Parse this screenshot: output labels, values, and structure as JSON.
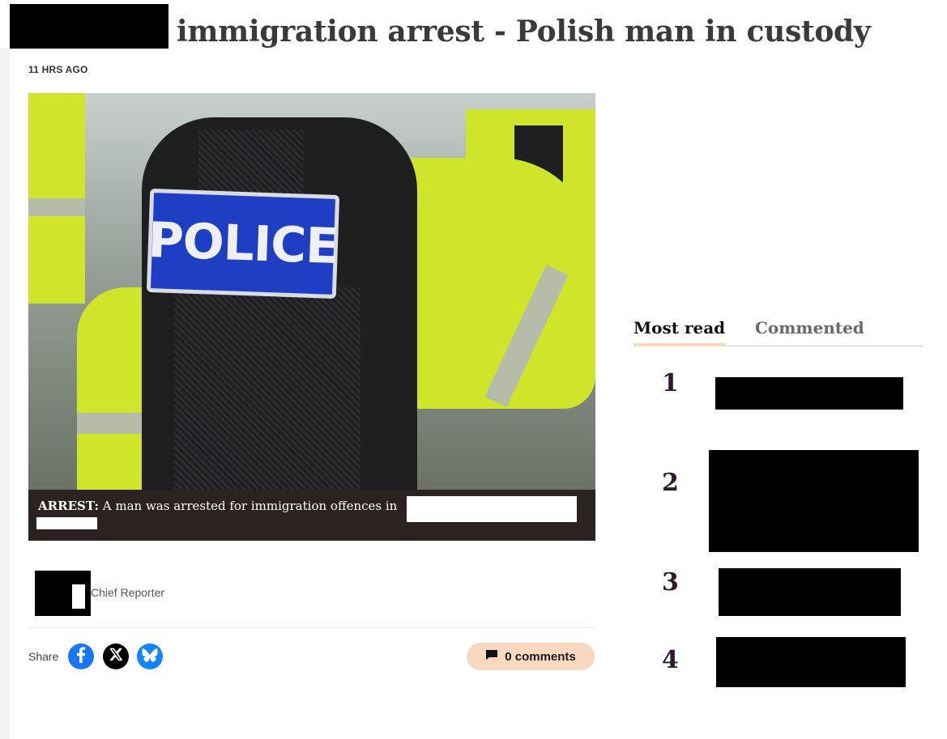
{
  "article": {
    "headline": "immigration arrest - Polish man in custody",
    "timestamp": "11 HRS AGO",
    "photo_badge_text": "POLICE",
    "caption_label": "ARREST:",
    "caption_text": " A man was arrested for immigration offences in",
    "author_role": "Chief Reporter"
  },
  "share": {
    "label": "Share",
    "buttons": [
      "facebook-icon",
      "x-icon",
      "bluesky-icon"
    ]
  },
  "comments": {
    "label": "0 comments",
    "icon": "comment-icon"
  },
  "sidebar": {
    "tabs": [
      {
        "label": "Most read",
        "active": true
      },
      {
        "label": "Commented",
        "active": false
      }
    ],
    "ranks": [
      "1",
      "2",
      "3",
      "4"
    ]
  },
  "colors": {
    "accent_peach": "#f8d9bf",
    "caption_bg": "#2a2322",
    "rank_color": "#2e1a2e",
    "facebook_blue": "#1877f2",
    "bluesky_blue": "#1185fe"
  }
}
